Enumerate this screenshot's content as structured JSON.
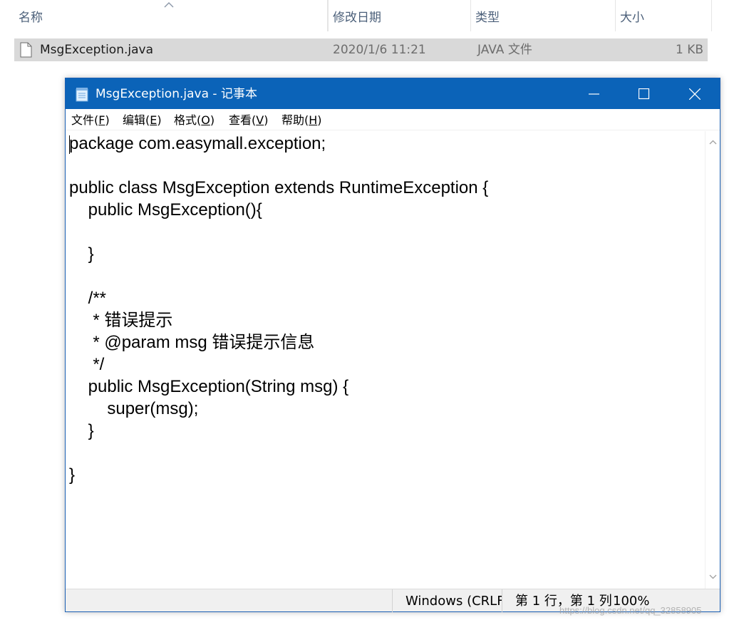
{
  "explorer": {
    "columns": {
      "name": "名称",
      "modified": "修改日期",
      "type": "类型",
      "size": "大小"
    },
    "files": [
      {
        "name": "MsgException.java",
        "modified": "2020/1/6 11:21",
        "type": "JAVA 文件",
        "size": "1 KB"
      }
    ]
  },
  "notepad": {
    "title": "MsgException.java - 记事本",
    "menu": {
      "file": "文件(",
      "file_key": "F",
      "edit": "编辑(",
      "edit_key": "E",
      "format": "格式(",
      "format_key": "O",
      "view": "查看(",
      "view_key": "V",
      "help": "帮助(",
      "help_key": "H",
      "close_paren": ")"
    },
    "content": "package com.easymall.exception;\n\npublic class MsgException extends RuntimeException {\n    public MsgException(){\n\n    }\n\n    /**\n     * 错误提示\n     * @param msg 错误提示信息\n     */\n    public MsgException(String msg) {\n        super(msg);\n    }\n\n}",
    "status": {
      "encoding": "Windows (CRLF",
      "position": "第 1 行，第 1 列",
      "zoom": "100%"
    }
  },
  "watermark": "https://blog.csdn.net/qq_32858905"
}
